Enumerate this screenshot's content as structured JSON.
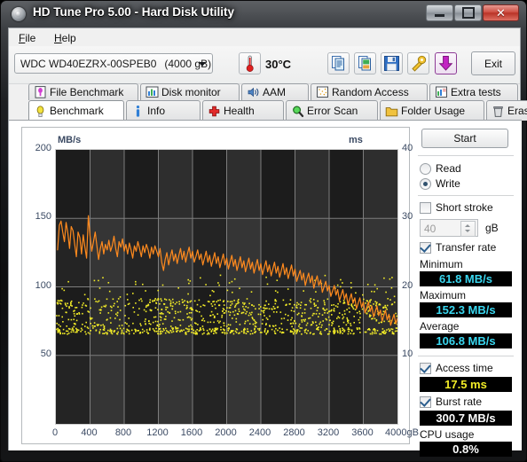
{
  "window": {
    "title": "HD Tune Pro 5.00 - Hard Disk Utility",
    "icon": "hdtune-disc-icon",
    "buttons": {
      "minimize": "minimize-button",
      "maximize": "maximize-button",
      "close": "close-button"
    }
  },
  "menu": {
    "items": [
      {
        "label": "File",
        "accel": "F"
      },
      {
        "label": "Help",
        "accel": "H"
      }
    ]
  },
  "toolbar": {
    "drive": {
      "model": "WDC WD40EZRX-00SPEB0",
      "capacity": "(4000 gB)"
    },
    "temperature": "30°C",
    "thermometer_icon": "thermometer-icon",
    "icons": [
      {
        "name": "copy-icon"
      },
      {
        "name": "copy-image-icon"
      },
      {
        "name": "save-icon"
      },
      {
        "name": "tools-icon"
      },
      {
        "name": "download-icon"
      }
    ],
    "exit_label": "Exit"
  },
  "tabs": {
    "top_row": [
      {
        "label": "File Benchmark",
        "icon": "file-benchmark-icon",
        "active": false
      },
      {
        "label": "Disk monitor",
        "icon": "disk-monitor-icon",
        "active": false
      },
      {
        "label": "AAM",
        "icon": "speaker-icon",
        "active": false
      },
      {
        "label": "Random Access",
        "icon": "random-access-icon",
        "active": false
      },
      {
        "label": "Extra tests",
        "icon": "extra-tests-icon",
        "active": false
      }
    ],
    "bottom_row": [
      {
        "label": "Benchmark",
        "icon": "lightbulb-icon",
        "active": true
      },
      {
        "label": "Info",
        "icon": "info-icon",
        "active": false
      },
      {
        "label": "Health",
        "icon": "health-cross-icon",
        "active": false
      },
      {
        "label": "Error Scan",
        "icon": "magnifier-icon",
        "active": false
      },
      {
        "label": "Folder Usage",
        "icon": "folder-icon",
        "active": false
      },
      {
        "label": "Erase",
        "icon": "trash-icon",
        "active": false
      }
    ]
  },
  "panel": {
    "start_label": "Start",
    "mode": {
      "read_label": "Read",
      "write_label": "Write",
      "selected": "Write"
    },
    "short_stroke": {
      "label": "Short stroke",
      "checked": false,
      "value": "40",
      "unit": "gB"
    },
    "transfer_rate": {
      "label": "Transfer rate",
      "checked": true
    },
    "minimum": {
      "label": "Minimum",
      "value": "61.8 MB/s",
      "color": "#39d7f0"
    },
    "maximum": {
      "label": "Maximum",
      "value": "152.3 MB/s",
      "color": "#39d7f0"
    },
    "average": {
      "label": "Average",
      "value": "106.8 MB/s",
      "color": "#39d7f0"
    },
    "access_time": {
      "label": "Access time",
      "checked": true,
      "value": "17.5 ms",
      "color": "#f2ec27"
    },
    "burst_rate": {
      "label": "Burst rate",
      "checked": true,
      "value": "300.7 MB/s",
      "color": "#ffffff"
    },
    "cpu_usage": {
      "label": "CPU usage",
      "value": "0.8%",
      "color": "#ffffff"
    }
  },
  "chart_data": {
    "type": "line",
    "title": "",
    "xlabel": "4000gB",
    "ylabel": "MB/s",
    "y2label": "ms",
    "xlim": [
      0,
      4000
    ],
    "ylim": [
      0,
      200
    ],
    "y2lim": [
      0,
      40
    ],
    "grid": true,
    "legend_position": "none",
    "xticks": [
      0,
      400,
      800,
      1200,
      1600,
      2000,
      2400,
      2800,
      3200,
      3600,
      4000
    ],
    "xtick_labels": [
      "0",
      "400",
      "800",
      "1200",
      "1600",
      "2000",
      "2400",
      "2800",
      "3200",
      "3600",
      "4000gB"
    ],
    "yticks": [
      50,
      100,
      150,
      200
    ],
    "ytick_labels": [
      "50",
      "100",
      "150",
      "200"
    ],
    "y2ticks": [
      10,
      20,
      30,
      40
    ],
    "y2tick_labels": [
      "10",
      "20",
      "30",
      "40"
    ],
    "colors": {
      "transfer": "#ff8a1e",
      "access": "#f2ec27",
      "background": "#1c1c1c",
      "grid": "#7d7d7d"
    },
    "series": [
      {
        "name": "Transfer rate",
        "axis": "left",
        "color": "#ff8a1e",
        "unit": "MB/s",
        "x": [
          20,
          40,
          60,
          80,
          100,
          120,
          140,
          160,
          180,
          200,
          220,
          240,
          260,
          280,
          300,
          320,
          340,
          360,
          380,
          400,
          420,
          440,
          460,
          480,
          500,
          520,
          540,
          560,
          580,
          600,
          620,
          640,
          660,
          680,
          700,
          720,
          740,
          760,
          780,
          800,
          820,
          840,
          860,
          880,
          900,
          920,
          940,
          960,
          980,
          1000,
          1020,
          1040,
          1060,
          1080,
          1100,
          1120,
          1140,
          1160,
          1180,
          1200,
          1220,
          1240,
          1260,
          1280,
          1300,
          1320,
          1340,
          1360,
          1380,
          1400,
          1420,
          1440,
          1460,
          1480,
          1500,
          1520,
          1540,
          1560,
          1580,
          1600,
          1620,
          1640,
          1660,
          1680,
          1700,
          1720,
          1740,
          1760,
          1780,
          1800,
          1820,
          1840,
          1860,
          1880,
          1900,
          1920,
          1940,
          1960,
          1980,
          2000,
          2020,
          2040,
          2060,
          2080,
          2100,
          2120,
          2140,
          2160,
          2180,
          2200,
          2220,
          2240,
          2260,
          2280,
          2300,
          2320,
          2340,
          2360,
          2380,
          2400,
          2420,
          2440,
          2460,
          2480,
          2500,
          2520,
          2540,
          2560,
          2580,
          2600,
          2620,
          2640,
          2660,
          2680,
          2700,
          2720,
          2740,
          2760,
          2780,
          2800,
          2820,
          2840,
          2860,
          2880,
          2900,
          2920,
          2940,
          2960,
          2980,
          3000,
          3020,
          3040,
          3060,
          3080,
          3100,
          3120,
          3140,
          3160,
          3180,
          3200,
          3220,
          3240,
          3260,
          3280,
          3300,
          3320,
          3340,
          3360,
          3380,
          3400,
          3420,
          3440,
          3460,
          3480,
          3500,
          3520,
          3540,
          3560,
          3580,
          3600,
          3620,
          3640,
          3660,
          3680,
          3700,
          3720,
          3740,
          3760,
          3780,
          3800,
          3820,
          3840,
          3860,
          3880,
          3900,
          3920,
          3940,
          3960,
          3980,
          4000
        ],
        "y": [
          127,
          145,
          148,
          140,
          133,
          147,
          139,
          128,
          144,
          141,
          131,
          122,
          140,
          136,
          124,
          138,
          129,
          121,
          152,
          137,
          126,
          133,
          140,
          130,
          120,
          128,
          133,
          124,
          131,
          127,
          134,
          126,
          130,
          137,
          128,
          122,
          133,
          129,
          135,
          126,
          131,
          124,
          132,
          127,
          121,
          130,
          126,
          133,
          128,
          122,
          130,
          125,
          131,
          127,
          121,
          129,
          124,
          130,
          126,
          122,
          128,
          118,
          112,
          120,
          125,
          116,
          122,
          127,
          119,
          124,
          117,
          123,
          128,
          120,
          126,
          118,
          124,
          129,
          121,
          126,
          118,
          122,
          127,
          120,
          124,
          116,
          121,
          126,
          118,
          123,
          115,
          120,
          125,
          117,
          122,
          114,
          119,
          124,
          116,
          121,
          113,
          118,
          123,
          115,
          120,
          112,
          117,
          122,
          114,
          119,
          111,
          116,
          121,
          113,
          118,
          110,
          115,
          120,
          112,
          117,
          109,
          114,
          119,
          111,
          116,
          108,
          113,
          118,
          110,
          115,
          107,
          112,
          117,
          109,
          114,
          106,
          111,
          116,
          108,
          113,
          104,
          108,
          112,
          105,
          110,
          101,
          106,
          110,
          103,
          108,
          99,
          104,
          108,
          101,
          105,
          96,
          100,
          104,
          97,
          101,
          93,
          97,
          101,
          94,
          98,
          90,
          94,
          98,
          91,
          95,
          87,
          91,
          95,
          88,
          92,
          84,
          88,
          92,
          85,
          89,
          81,
          85,
          89,
          82,
          86,
          78,
          82,
          86,
          79,
          83,
          75,
          79,
          83,
          76,
          80,
          72,
          76,
          80,
          73,
          77,
          69,
          73,
          77,
          70,
          74,
          66,
          70,
          74,
          67,
          65
        ]
      },
      {
        "name": "Access time",
        "axis": "right",
        "color": "#f2ec27",
        "unit": "ms",
        "note": "scatter cloud of per-sample seek times, bulk between 14 and 20 ms with a dense band along the bottom baseline",
        "mean": 17.5,
        "min": 13.5,
        "max": 21.5
      }
    ]
  }
}
